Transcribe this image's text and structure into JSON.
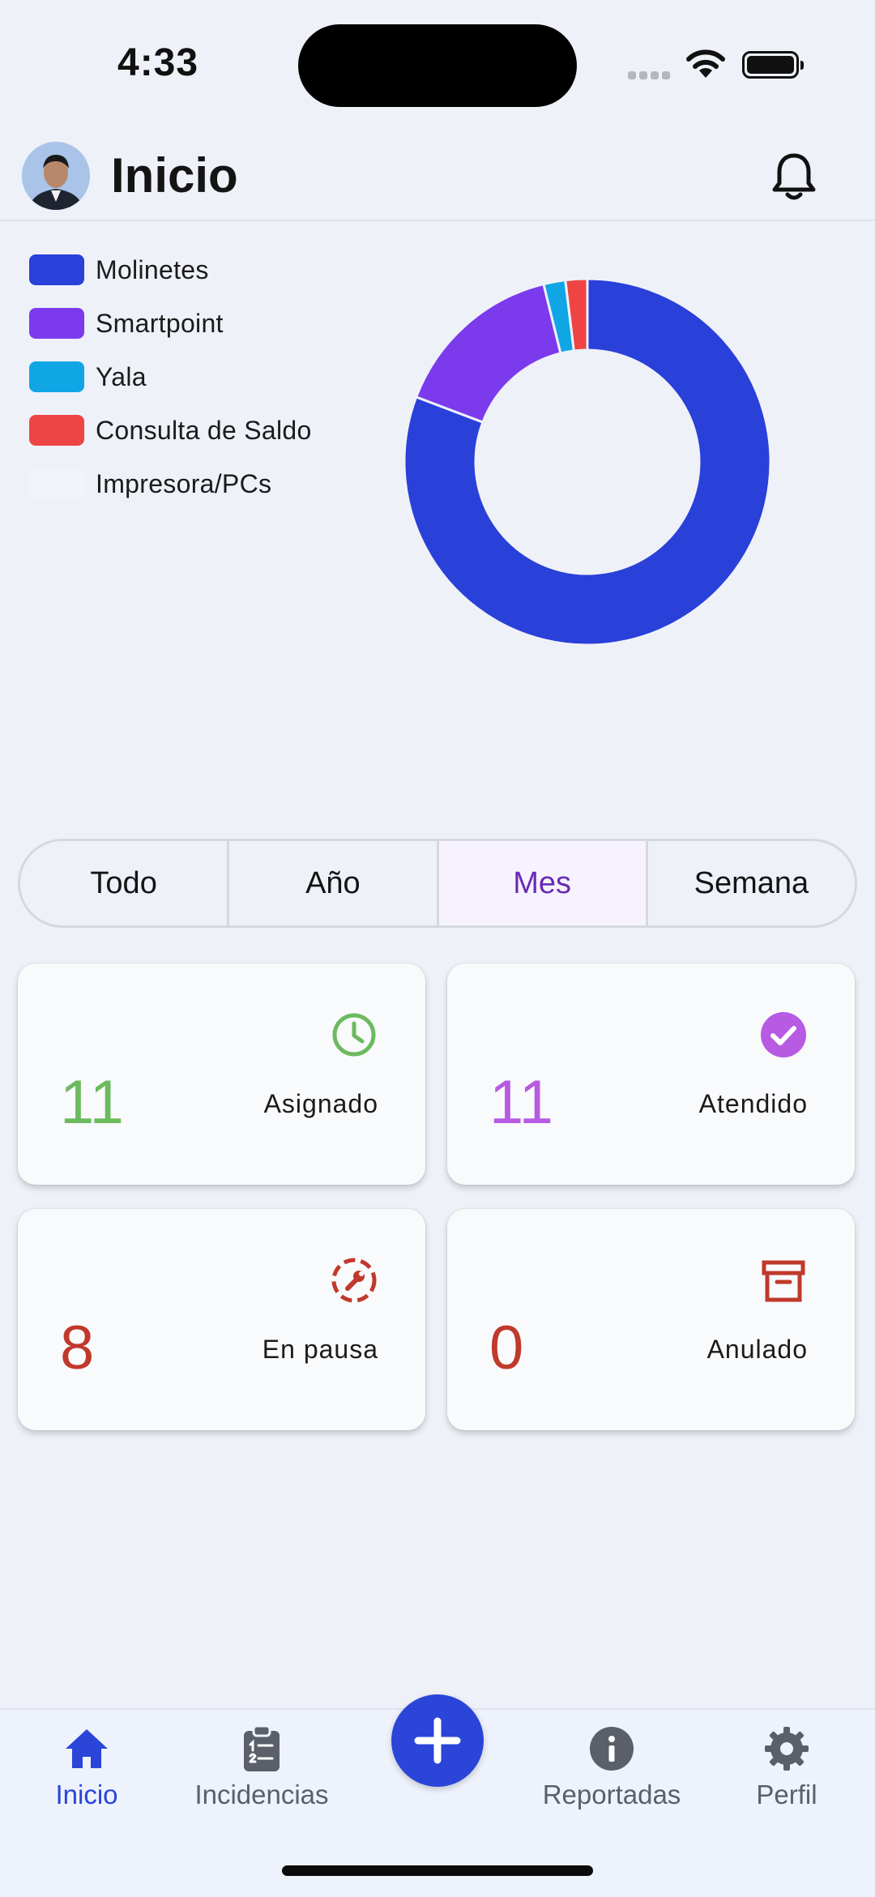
{
  "status_bar": {
    "time": "4:33"
  },
  "header": {
    "title": "Inicio"
  },
  "chart_data": {
    "type": "pie",
    "donut": true,
    "legend_position": "left",
    "categories": [
      "Molinetes",
      "Smartpoint",
      "Yala",
      "Consulta de Saldo",
      "Impresora/PCs"
    ],
    "values": [
      21,
      4,
      0.5,
      0.5,
      0
    ],
    "colors": [
      "#2940d9",
      "#7c3aed",
      "#10a6e6",
      "#ef4444",
      "#f3f4fb"
    ]
  },
  "filters": {
    "options": [
      "Todo",
      "Año",
      "Mes",
      "Semana"
    ],
    "selected": "Mes"
  },
  "stats": {
    "asignado": {
      "count": "11",
      "label": "Asignado",
      "color": "#6cba5e",
      "icon": "clock-icon"
    },
    "atendido": {
      "count": "11",
      "label": "Atendido",
      "color": "#b75be2",
      "icon": "check-circle-icon"
    },
    "en_pausa": {
      "count": "8",
      "label": "En pausa",
      "color": "#c0392b",
      "icon": "wrench-icon"
    },
    "anulado": {
      "count": "0",
      "label": "Anulado",
      "color": "#c0392b",
      "icon": "archive-icon"
    }
  },
  "nav": {
    "items": [
      {
        "label": "Inicio",
        "icon": "home-icon",
        "active": true
      },
      {
        "label": "Incidencias",
        "icon": "clipboard-list-icon",
        "active": false
      },
      {
        "label": "Reportadas",
        "icon": "info-icon",
        "active": false
      },
      {
        "label": "Perfil",
        "icon": "gear-icon",
        "active": false
      }
    ],
    "fab_icon": "plus-icon"
  },
  "colors": {
    "accent": "#2a45d8",
    "selected_filter": "#6a2bb3"
  }
}
